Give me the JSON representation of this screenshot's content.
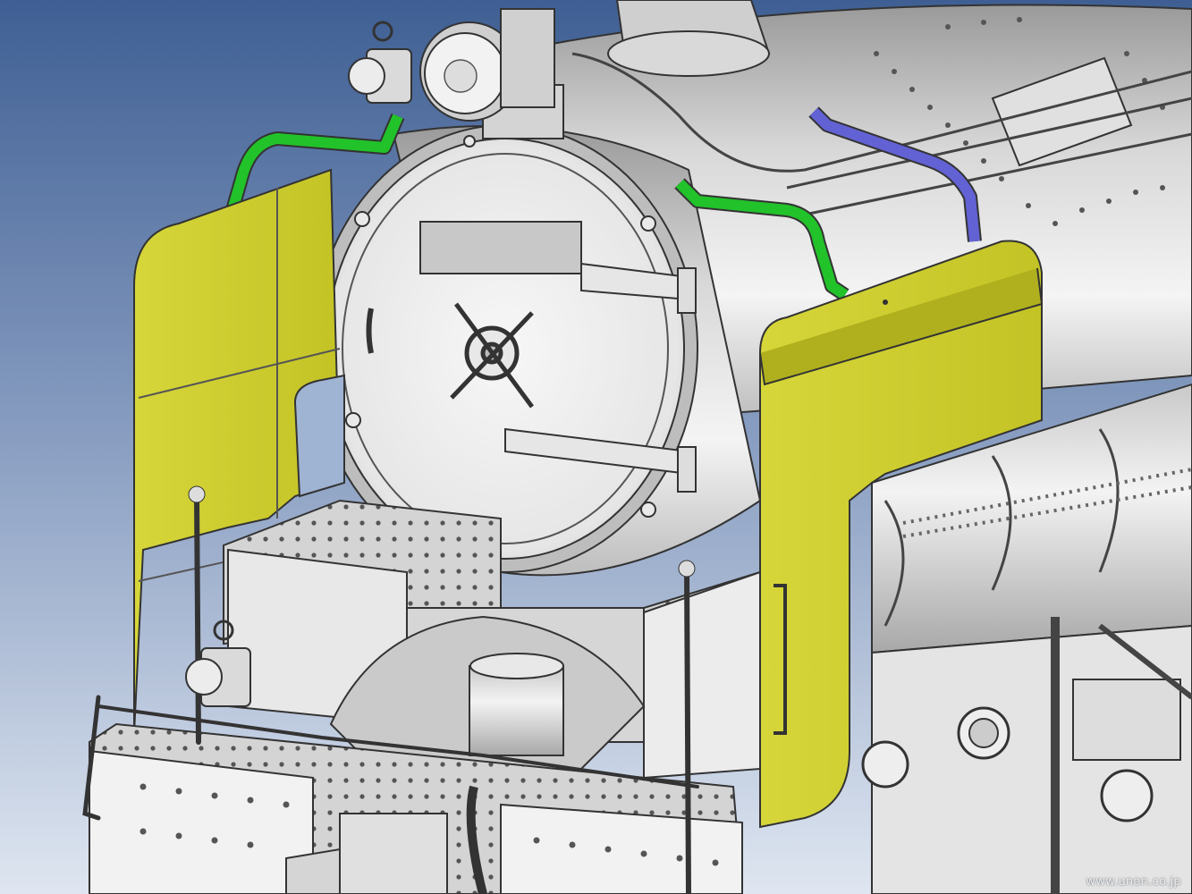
{
  "watermark": {
    "text": "www.unon.co.jp"
  },
  "colors": {
    "sky_top": "#3f5f94",
    "sky_bottom": "#dfe6f1",
    "smoke_deflector": "#cccc2e",
    "handrail_green": "#22c22a",
    "handrail_blue": "#6262d4",
    "metal": "#dcdcdc",
    "outline": "#333333"
  },
  "model": {
    "subject": "steam-locomotive-front-cad-model",
    "highlighted_parts": [
      "smoke-deflector-left",
      "smoke-deflector-right",
      "handrail-green",
      "handrail-blue"
    ]
  }
}
